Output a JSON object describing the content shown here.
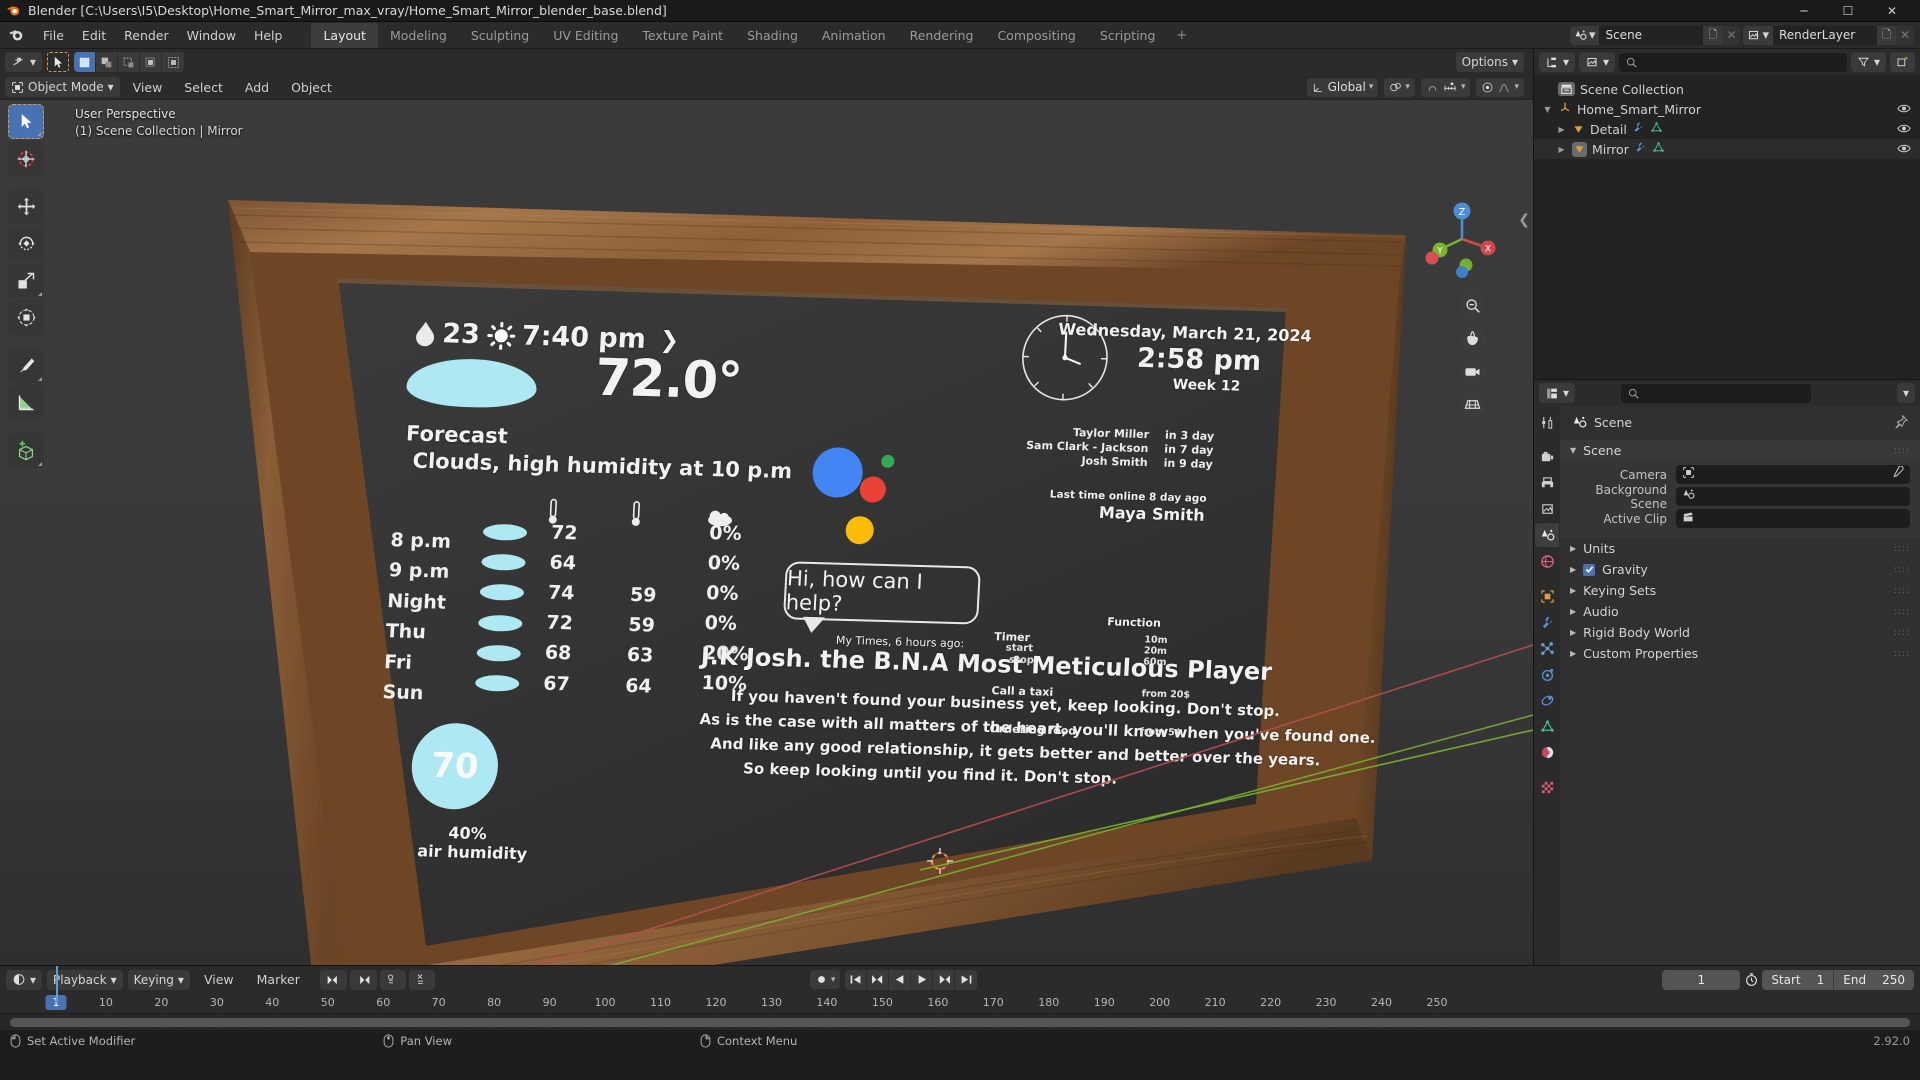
{
  "window": {
    "title": "Blender [C:\\Users\\I5\\Desktop\\Home_Smart_Mirror_max_vray/Home_Smart_Mirror_blender_base.blend]",
    "minimize": "─",
    "maximize": "☐",
    "close": "✕"
  },
  "topbar": {
    "menus": [
      "File",
      "Edit",
      "Render",
      "Window",
      "Help"
    ],
    "workspaces": [
      "Layout",
      "Modeling",
      "Sculpting",
      "UV Editing",
      "Texture Paint",
      "Shading",
      "Animation",
      "Rendering",
      "Compositing",
      "Scripting"
    ],
    "active_workspace": "Layout",
    "add_workspace": "+",
    "scene_name": "Scene",
    "viewlayer_name": "RenderLayer"
  },
  "viewport": {
    "mode": "Object Mode",
    "menus": [
      "View",
      "Select",
      "Add",
      "Object"
    ],
    "transform_orientation": "Global",
    "options_label": "Options",
    "info_line1": "User Perspective",
    "info_line2": "(1) Scene Collection | Mirror",
    "gizmo_axes": {
      "x": "X",
      "y": "Y",
      "z": "Z"
    },
    "tools": [
      "tweak-select-tool",
      "cursor-tool",
      "move-tool",
      "rotate-tool",
      "scale-tool",
      "transform-tool",
      "annotate-tool",
      "measure-tool",
      "add-cube-tool"
    ]
  },
  "outliner": {
    "display_mode": "view-layer-icon",
    "search_placeholder": "",
    "rows": [
      {
        "label": "Scene Collection",
        "indent": 0,
        "icon": "collection-icon",
        "expander": "",
        "eye": false
      },
      {
        "label": "Home_Smart_Mirror",
        "indent": 0,
        "icon": "empty-icon",
        "expander": "▼",
        "eye": true
      },
      {
        "label": "Detail",
        "indent": 1,
        "icon": "mesh-data-icon",
        "expander": "▶",
        "eye": true
      },
      {
        "label": "Mirror",
        "indent": 1,
        "icon": "mesh-data-icon",
        "expander": "▶",
        "eye": true
      }
    ]
  },
  "properties": {
    "search_placeholder": "",
    "breadcrumb": "Scene",
    "tabs": [
      "tool-icon",
      "render-icon",
      "output-icon",
      "view-layer-icon",
      "scene-icon",
      "world-icon",
      "object-icon",
      "modifier-icon",
      "particles-icon",
      "physics-icon",
      "constraints-icon",
      "data-icon",
      "material-icon",
      "texture-icon"
    ],
    "active_tab": "scene-icon",
    "panels": [
      {
        "label": "Scene",
        "open": true
      },
      {
        "label": "Units",
        "open": false
      },
      {
        "label": "Gravity",
        "open": false,
        "checkbox": true
      },
      {
        "label": "Keying Sets",
        "open": false
      },
      {
        "label": "Audio",
        "open": false
      },
      {
        "label": "Rigid Body World",
        "open": false
      },
      {
        "label": "Custom Properties",
        "open": false
      }
    ],
    "scene_fields": [
      {
        "label": "Camera",
        "value": "",
        "icon": "camera-icon",
        "eyedropper": true
      },
      {
        "label": "Background Scene",
        "value": "",
        "icon": "scene-icon",
        "eyedropper": false
      },
      {
        "label": "Active Clip",
        "value": "",
        "icon": "clip-icon",
        "eyedropper": false
      }
    ]
  },
  "timeline": {
    "menus": [
      "Playback",
      "Keying",
      "View",
      "Marker"
    ],
    "current_frame": "1",
    "start_label": "Start",
    "start_value": "1",
    "end_label": "End",
    "end_value": "250",
    "ticks": [
      1,
      10,
      20,
      30,
      40,
      50,
      60,
      70,
      80,
      90,
      100,
      110,
      120,
      130,
      140,
      150,
      160,
      170,
      180,
      190,
      200,
      210,
      220,
      230,
      240,
      250
    ],
    "playhead_frame": 1
  },
  "statusbar": {
    "items": [
      "Set Active Modifier",
      "Pan View",
      "Context Menu"
    ],
    "version": "2.92.0"
  },
  "mirror": {
    "weather_top": {
      "precip": "23",
      "time": "7:40 pm",
      "chevron": "❯"
    },
    "temperature": "72.0°",
    "forecast_label": "Forecast",
    "forecast_text": "Clouds, high humidity at 10 p.m",
    "forecast_rows": [
      {
        "when": "8 p.m",
        "high": "72",
        "low": "",
        "rain": "0%"
      },
      {
        "when": "9 p.m",
        "high": "64",
        "low": "",
        "rain": "0%"
      },
      {
        "when": "Night",
        "high": "74",
        "low": "59",
        "rain": "0%"
      },
      {
        "when": "Thu",
        "high": "72",
        "low": "59",
        "rain": "0%"
      },
      {
        "when": "Fri",
        "high": "68",
        "low": "63",
        "rain": "20%"
      },
      {
        "when": "Sun",
        "high": "67",
        "low": "64",
        "rain": "10%"
      }
    ],
    "humidity_value": "70",
    "humidity_pct": "40%",
    "humidity_label": "air humidity",
    "date": "Wednesday, March 21, 2024",
    "clock": "2:58 pm",
    "week": "Week 12",
    "birthdays": [
      {
        "name": "Taylor Miller",
        "when": "in 3 day"
      },
      {
        "name": "Sam Clark - Jackson",
        "when": "in 7 day"
      },
      {
        "name": "Josh Smith",
        "when": "in 9 day"
      }
    ],
    "last_online_label": "Last time online 8 day ago",
    "last_online_name": "Maya Smith",
    "assistant_bubble": "Hi, how can I help?",
    "news_kicker": "My Times, 6 hours ago:",
    "news_headline": "J.K Josh. the B.N.A Most Meticulous Player",
    "news_body": [
      "If you haven't found your business yet, keep looking. Don't stop.",
      "As is the case with all matters of the heart, you'll know when you've found one.",
      "And like any good relationship, it gets better and better over the years.",
      "So keep looking until you find it. Don't stop."
    ],
    "functions_title": "Function",
    "functions": [
      {
        "name": "Timer",
        "sub": [
          "start",
          "stop"
        ],
        "values": [
          "10m",
          "20m",
          "60m"
        ]
      },
      {
        "name": "Call a taxi",
        "sub": [],
        "values": [
          "from 20$"
        ]
      },
      {
        "name": "Ordering food",
        "sub": [],
        "values": [
          "from 5$"
        ]
      }
    ]
  },
  "colors": {
    "accent_blue": "#4772b3",
    "mirror_cyan": "#aee8f2",
    "frame_wood": "#7c5230",
    "screen_dark": "#343434",
    "axis_x": "#cc4a4a",
    "axis_y": "#7ab530",
    "axis_z": "#4a8fd4"
  }
}
